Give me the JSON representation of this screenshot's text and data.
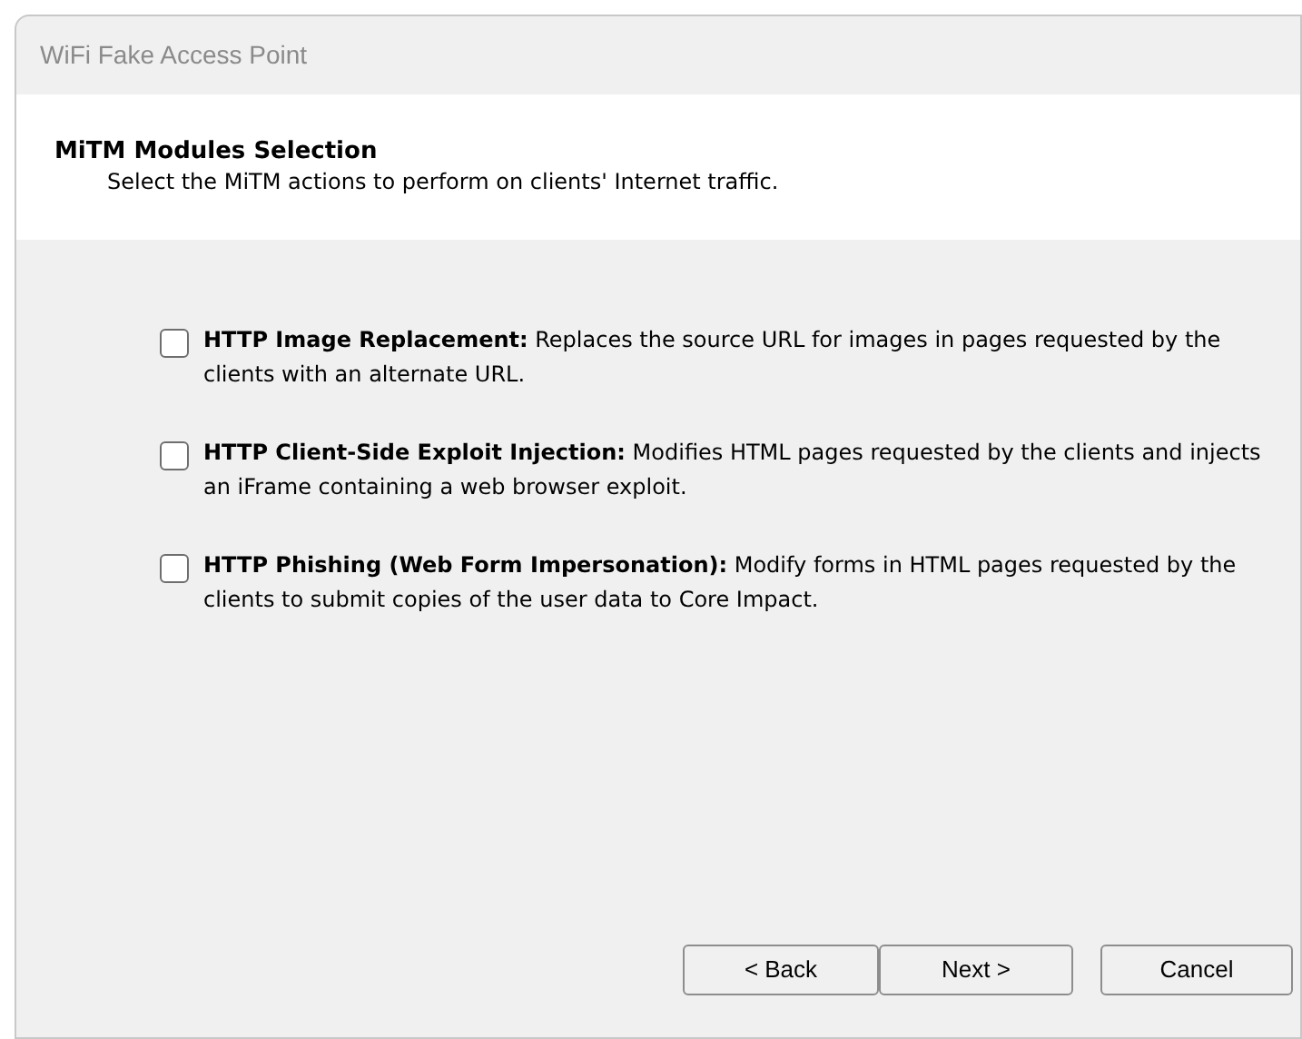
{
  "window": {
    "title": "WiFi Fake Access Point"
  },
  "header": {
    "title": "MiTM Modules Selection",
    "subtitle": "Select the MiTM actions to perform on clients' Internet traffic."
  },
  "options": [
    {
      "text": "**HTTP Image Replacement:** Replaces the source URL for images in pages requested by the clients with an alternate URL.",
      "checked": false
    },
    {
      "text": "**HTTP Client-Side Exploit Injection:** Modifies HTML pages requested by the clients and injects an iFrame containing a web browser exploit.",
      "checked": false
    },
    {
      "text": "**HTTP Phishing (Web Form Impersonation):** Modify forms in HTML pages requested by the clients to submit copies of the user data to Core Impact.",
      "checked": false
    }
  ],
  "buttons": {
    "back": "< Back",
    "next": "Next >",
    "cancel": "Cancel"
  }
}
